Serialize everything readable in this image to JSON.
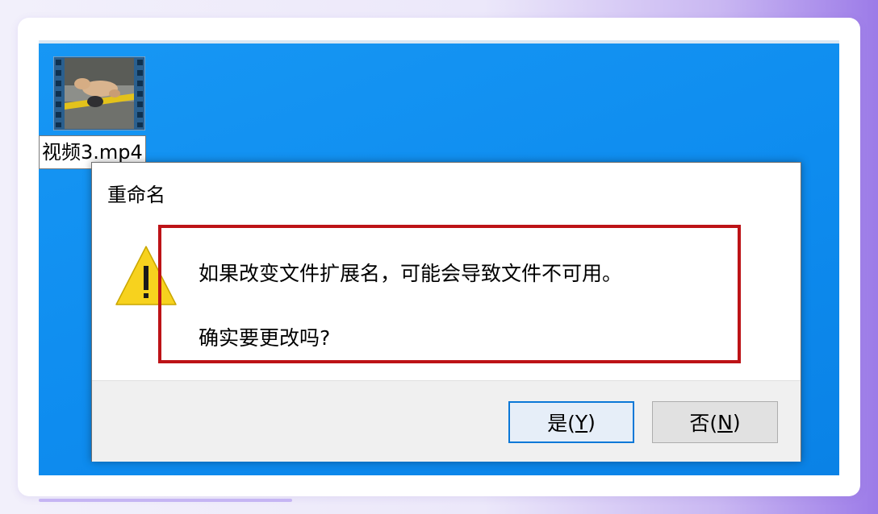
{
  "file": {
    "name": "视频3.mp4",
    "icon": "video-file-icon"
  },
  "dialog": {
    "title": "重命名",
    "icon": "warning-icon",
    "message_line1": "如果改变文件扩展名，可能会导致文件不可用。",
    "message_line2": "确实要更改吗?",
    "highlight_color": "#bd1317"
  },
  "buttons": {
    "yes": {
      "label": "是(",
      "mnemonic": "Y",
      "suffix": ")"
    },
    "no": {
      "label": "否(",
      "mnemonic": "N",
      "suffix": ")"
    }
  },
  "colors": {
    "desktop": "#0e8cef",
    "default_button_border": "#0a78d7"
  }
}
